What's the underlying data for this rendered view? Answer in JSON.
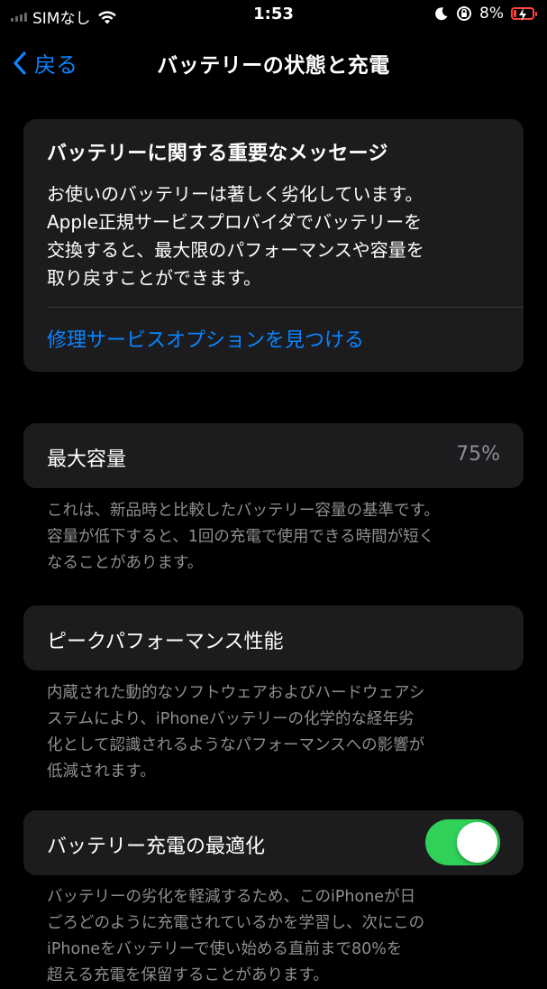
{
  "status_bar": {
    "carrier": "SIMなし",
    "time": "1:53",
    "battery_percent": "8%",
    "icons": [
      "signal-icon",
      "wifi-icon",
      "moon-icon",
      "orientation-lock-icon",
      "battery-charging-icon"
    ],
    "battery_color": "#ff453a"
  },
  "nav": {
    "back_label": "戻る",
    "title": "バッテリーの状態と充電"
  },
  "message": {
    "title": "バッテリーに関する重要なメッセージ",
    "lines": [
      "お使いのバッテリーは著しく劣化しています。",
      "Apple正規サービスプロバイダでバッテリーを",
      "交換すると、最大限のパフォーマンスや容量を",
      "取り戻すことができます。"
    ],
    "link": "修理サービスオプションを見つける"
  },
  "max_capacity": {
    "label": "最大容量",
    "value": "75%",
    "footnote_lines": [
      "これは、新品時と比較したバッテリー容量の基準です。",
      "容量が低下すると、1回の充電で使用できる時間が短く",
      "なることがあります。"
    ]
  },
  "peak_performance": {
    "label": "ピークパフォーマンス性能",
    "footnote_lines": [
      "内蔵された動的なソフトウェアおよびハードウェアシ",
      "ステムにより、iPhoneバッテリーの化学的な経年劣",
      "化として認識されるようなパフォーマンスへの影響が",
      "低減されます。"
    ]
  },
  "optimized_charging": {
    "label": "バッテリー充電の最適化",
    "enabled": true,
    "toggle_color": "#30d158",
    "footnote_lines": [
      "バッテリーの劣化を軽減するため、このiPhoneが日",
      "ごろどのように充電されているかを学習し、次にこの",
      "iPhoneをバッテリーで使い始める直前まで80%を",
      "超える充電を保留することがあります。"
    ]
  },
  "colors": {
    "accent": "#0a84ff",
    "background": "#000000",
    "card": "#1c1c1e",
    "secondary_text": "#8e8e93"
  }
}
